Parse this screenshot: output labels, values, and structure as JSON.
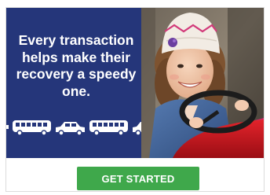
{
  "ad": {
    "headline": "Every transaction helps make their recovery a speedy one.",
    "cta_label": "GET STARTED",
    "vehicle_icons": [
      "bus-icon",
      "car-icon",
      "bus-icon",
      "car-icon"
    ],
    "colors": {
      "panel_blue": "#25367a",
      "button_green": "#3fa84b",
      "text_white": "#ffffff"
    }
  }
}
